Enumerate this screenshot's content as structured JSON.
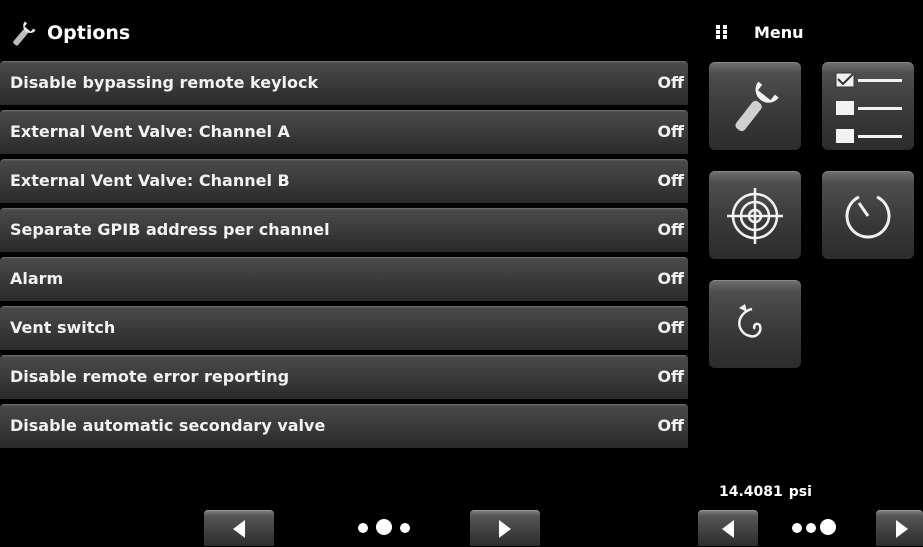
{
  "header": {
    "title": "Options",
    "icon": "wrench-icon"
  },
  "options": [
    {
      "label": "Disable bypassing remote keylock",
      "value": "Off"
    },
    {
      "label": "External Vent Valve: Channel A",
      "value": "Off"
    },
    {
      "label": "External Vent Valve: Channel B",
      "value": "Off"
    },
    {
      "label": "Separate GPIB address per channel",
      "value": "Off"
    },
    {
      "label": "Alarm",
      "value": "Off"
    },
    {
      "label": "Vent switch",
      "value": "Off"
    },
    {
      "label": "Disable remote error reporting",
      "value": "Off"
    },
    {
      "label": "Disable automatic secondary valve",
      "value": "Off"
    }
  ],
  "menu": {
    "title": "Menu",
    "icon": "grid-dots-icon",
    "tiles": [
      {
        "name": "settings",
        "icon": "wrench-icon",
        "active": true
      },
      {
        "name": "checklist",
        "icon": "checklist-icon",
        "active": false
      },
      {
        "name": "target",
        "icon": "crosshair-target-icon",
        "active": false
      },
      {
        "name": "timer",
        "icon": "stopwatch-icon",
        "active": false
      },
      {
        "name": "vent",
        "icon": "spiral-icon",
        "active": false
      }
    ]
  },
  "status": {
    "pressure_value": "14.4081",
    "pressure_unit": "psi"
  },
  "pagination": {
    "left": {
      "prev_icon": "triangle-left-icon",
      "next_icon": "triangle-right-icon",
      "page_count": 3,
      "current_page": 2
    },
    "right": {
      "prev_icon": "triangle-left-icon",
      "next_icon": "triangle-right-icon",
      "page_count": 3,
      "current_page": 3
    }
  }
}
